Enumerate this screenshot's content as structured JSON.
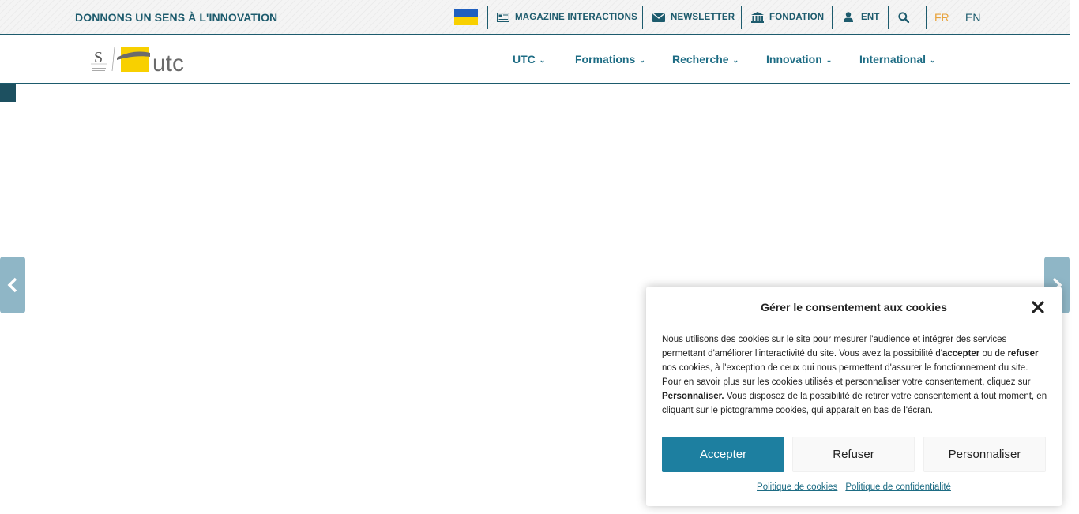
{
  "topbar": {
    "slogan": "DONNONS UN SENS À L'INNOVATION",
    "items": [
      {
        "label": "MAGAZINE INTERACTIONS",
        "icon": "newspaper-icon"
      },
      {
        "label": "NEWSLETTER",
        "icon": "envelope-icon"
      },
      {
        "label": "FONDATION",
        "icon": "institution-icon"
      },
      {
        "label": "ENT",
        "icon": "user-icon"
      }
    ],
    "search_icon": "search-icon",
    "flag": "ukraine-flag",
    "languages": [
      {
        "code": "FR",
        "active": true
      },
      {
        "code": "EN",
        "active": false
      }
    ]
  },
  "header": {
    "logo_text": "utc",
    "nav": [
      {
        "label": "UTC"
      },
      {
        "label": "Formations"
      },
      {
        "label": "Recherche"
      },
      {
        "label": "Innovation"
      },
      {
        "label": "International"
      }
    ]
  },
  "cookie": {
    "title": "Gérer le consentement aux cookies",
    "text_parts": [
      "Nous utilisons des cookies sur le site pour mesurer l'audience et intégrer des services permettant d'améliorer l'interactivité du site. Vous avez la possibilité d'",
      "accepter",
      " ou de ",
      "refuser",
      " nos cookies, à l'exception de ceux qui nous permettent d'assurer le fonctionnement du site. Pour en savoir plus sur les cookies utilisés et personnaliser votre consentement, cliquez sur ",
      "Personnaliser.",
      " Vous disposez de la possibilité de retirer votre consentement à tout moment, en cliquant sur le pictogramme cookies, qui apparait en bas de l'écran."
    ],
    "accept_label": "Accepter",
    "refuse_label": "Refuser",
    "customize_label": "Personnaliser",
    "links": [
      "Politique de cookies",
      "Politique de confidentialité"
    ]
  },
  "colors": {
    "primary": "#1d5b6d",
    "accent_button": "#1d7fa0",
    "logo_yellow": "#f8d000",
    "active_lang": "#e8a33c"
  }
}
